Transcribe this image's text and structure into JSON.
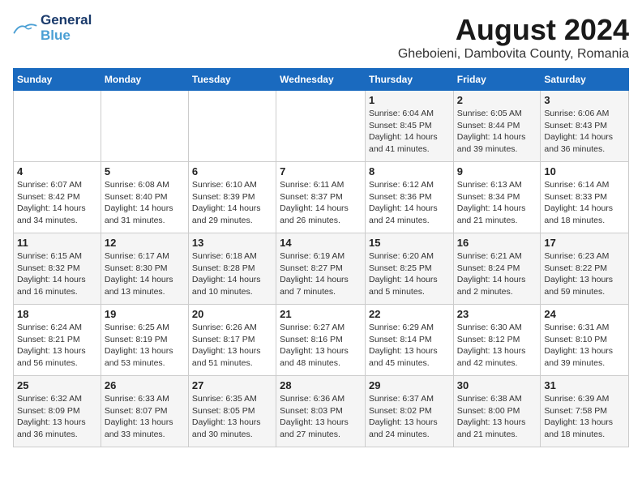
{
  "header": {
    "logo_line1": "General",
    "logo_line2": "Blue",
    "main_title": "August 2024",
    "subtitle": "Gheboieni, Dambovita County, Romania"
  },
  "weekdays": [
    "Sunday",
    "Monday",
    "Tuesday",
    "Wednesday",
    "Thursday",
    "Friday",
    "Saturday"
  ],
  "weeks": [
    [
      {
        "day": "",
        "info": ""
      },
      {
        "day": "",
        "info": ""
      },
      {
        "day": "",
        "info": ""
      },
      {
        "day": "",
        "info": ""
      },
      {
        "day": "1",
        "info": "Sunrise: 6:04 AM\nSunset: 8:45 PM\nDaylight: 14 hours\nand 41 minutes."
      },
      {
        "day": "2",
        "info": "Sunrise: 6:05 AM\nSunset: 8:44 PM\nDaylight: 14 hours\nand 39 minutes."
      },
      {
        "day": "3",
        "info": "Sunrise: 6:06 AM\nSunset: 8:43 PM\nDaylight: 14 hours\nand 36 minutes."
      }
    ],
    [
      {
        "day": "4",
        "info": "Sunrise: 6:07 AM\nSunset: 8:42 PM\nDaylight: 14 hours\nand 34 minutes."
      },
      {
        "day": "5",
        "info": "Sunrise: 6:08 AM\nSunset: 8:40 PM\nDaylight: 14 hours\nand 31 minutes."
      },
      {
        "day": "6",
        "info": "Sunrise: 6:10 AM\nSunset: 8:39 PM\nDaylight: 14 hours\nand 29 minutes."
      },
      {
        "day": "7",
        "info": "Sunrise: 6:11 AM\nSunset: 8:37 PM\nDaylight: 14 hours\nand 26 minutes."
      },
      {
        "day": "8",
        "info": "Sunrise: 6:12 AM\nSunset: 8:36 PM\nDaylight: 14 hours\nand 24 minutes."
      },
      {
        "day": "9",
        "info": "Sunrise: 6:13 AM\nSunset: 8:34 PM\nDaylight: 14 hours\nand 21 minutes."
      },
      {
        "day": "10",
        "info": "Sunrise: 6:14 AM\nSunset: 8:33 PM\nDaylight: 14 hours\nand 18 minutes."
      }
    ],
    [
      {
        "day": "11",
        "info": "Sunrise: 6:15 AM\nSunset: 8:32 PM\nDaylight: 14 hours\nand 16 minutes."
      },
      {
        "day": "12",
        "info": "Sunrise: 6:17 AM\nSunset: 8:30 PM\nDaylight: 14 hours\nand 13 minutes."
      },
      {
        "day": "13",
        "info": "Sunrise: 6:18 AM\nSunset: 8:28 PM\nDaylight: 14 hours\nand 10 minutes."
      },
      {
        "day": "14",
        "info": "Sunrise: 6:19 AM\nSunset: 8:27 PM\nDaylight: 14 hours\nand 7 minutes."
      },
      {
        "day": "15",
        "info": "Sunrise: 6:20 AM\nSunset: 8:25 PM\nDaylight: 14 hours\nand 5 minutes."
      },
      {
        "day": "16",
        "info": "Sunrise: 6:21 AM\nSunset: 8:24 PM\nDaylight: 14 hours\nand 2 minutes."
      },
      {
        "day": "17",
        "info": "Sunrise: 6:23 AM\nSunset: 8:22 PM\nDaylight: 13 hours\nand 59 minutes."
      }
    ],
    [
      {
        "day": "18",
        "info": "Sunrise: 6:24 AM\nSunset: 8:21 PM\nDaylight: 13 hours\nand 56 minutes."
      },
      {
        "day": "19",
        "info": "Sunrise: 6:25 AM\nSunset: 8:19 PM\nDaylight: 13 hours\nand 53 minutes."
      },
      {
        "day": "20",
        "info": "Sunrise: 6:26 AM\nSunset: 8:17 PM\nDaylight: 13 hours\nand 51 minutes."
      },
      {
        "day": "21",
        "info": "Sunrise: 6:27 AM\nSunset: 8:16 PM\nDaylight: 13 hours\nand 48 minutes."
      },
      {
        "day": "22",
        "info": "Sunrise: 6:29 AM\nSunset: 8:14 PM\nDaylight: 13 hours\nand 45 minutes."
      },
      {
        "day": "23",
        "info": "Sunrise: 6:30 AM\nSunset: 8:12 PM\nDaylight: 13 hours\nand 42 minutes."
      },
      {
        "day": "24",
        "info": "Sunrise: 6:31 AM\nSunset: 8:10 PM\nDaylight: 13 hours\nand 39 minutes."
      }
    ],
    [
      {
        "day": "25",
        "info": "Sunrise: 6:32 AM\nSunset: 8:09 PM\nDaylight: 13 hours\nand 36 minutes."
      },
      {
        "day": "26",
        "info": "Sunrise: 6:33 AM\nSunset: 8:07 PM\nDaylight: 13 hours\nand 33 minutes."
      },
      {
        "day": "27",
        "info": "Sunrise: 6:35 AM\nSunset: 8:05 PM\nDaylight: 13 hours\nand 30 minutes."
      },
      {
        "day": "28",
        "info": "Sunrise: 6:36 AM\nSunset: 8:03 PM\nDaylight: 13 hours\nand 27 minutes."
      },
      {
        "day": "29",
        "info": "Sunrise: 6:37 AM\nSunset: 8:02 PM\nDaylight: 13 hours\nand 24 minutes."
      },
      {
        "day": "30",
        "info": "Sunrise: 6:38 AM\nSunset: 8:00 PM\nDaylight: 13 hours\nand 21 minutes."
      },
      {
        "day": "31",
        "info": "Sunrise: 6:39 AM\nSunset: 7:58 PM\nDaylight: 13 hours\nand 18 minutes."
      }
    ]
  ]
}
